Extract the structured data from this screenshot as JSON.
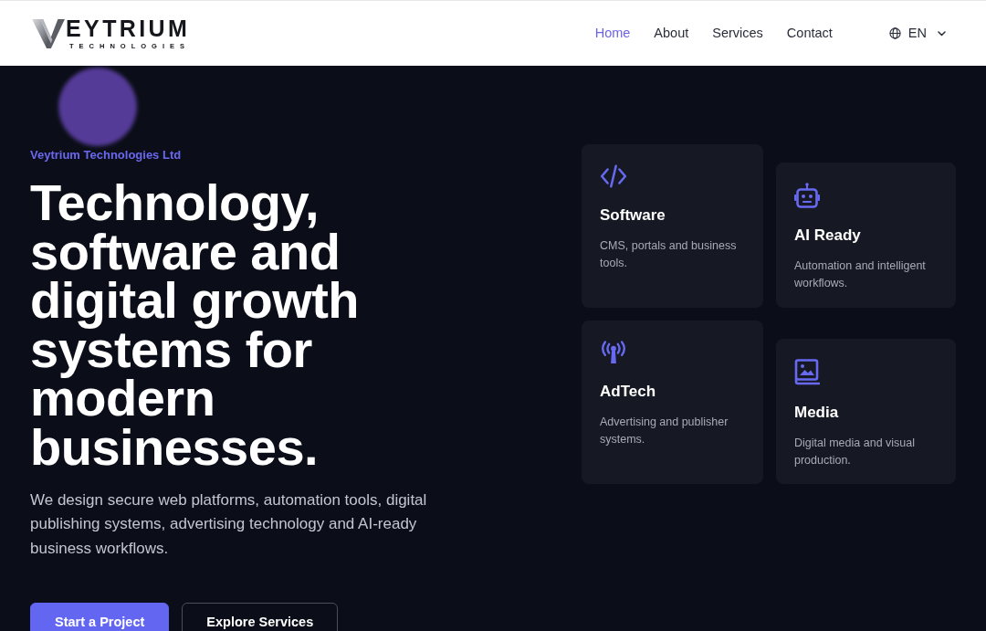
{
  "navbar": {
    "logo": {
      "wordmark": "EYTRIUM",
      "tagline": "TECHNOLOGIES"
    },
    "links": [
      {
        "label": "Home",
        "selected": true
      },
      {
        "label": "About",
        "selected": false
      },
      {
        "label": "Services",
        "selected": false
      },
      {
        "label": "Contact",
        "selected": false
      }
    ],
    "language": {
      "label": "EN"
    }
  },
  "hero": {
    "eyebrow": "Veytrium Technologies Ltd",
    "heading": "Technology, software and digital growth systems for modern businesses.",
    "lead": "We design secure web platforms, automation tools, digital publishing systems, advertising technology and AI-ready business workflows.",
    "buttons": [
      {
        "label": "Start a Project",
        "kind": "primary"
      },
      {
        "label": "Explore Services",
        "kind": "outline"
      }
    ]
  },
  "services": [
    {
      "title": "Software",
      "description": "CMS, portals and business tools."
    },
    {
      "title": "AI Ready",
      "description": "Automation and intelligent workflows."
    },
    {
      "title": "AdTech",
      "description": "Advertising and publisher systems."
    },
    {
      "title": "Media",
      "description": "Digital media and visual production."
    }
  ]
}
